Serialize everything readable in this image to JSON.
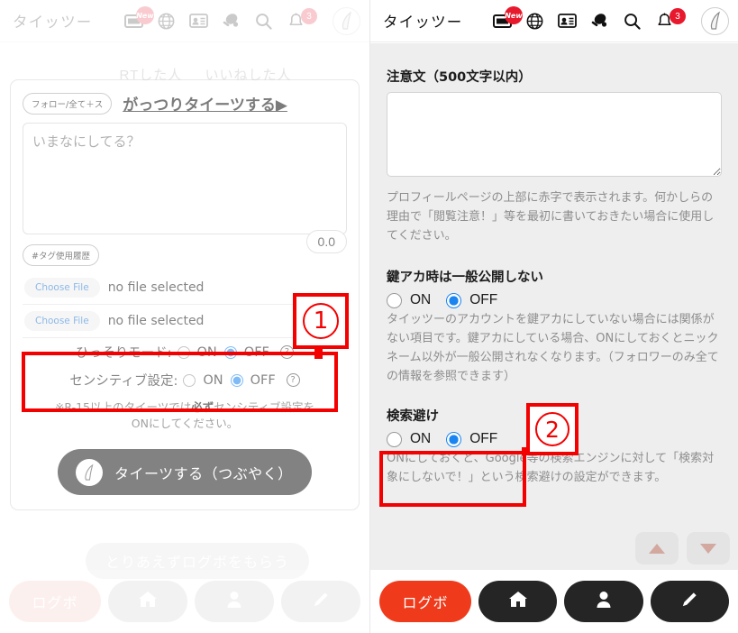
{
  "header": {
    "brand": "タイッツー",
    "icons": [
      {
        "name": "ticket-icon",
        "badge": "New"
      },
      {
        "name": "globe-icon",
        "badge": null
      },
      {
        "name": "id-card-icon",
        "badge": null
      },
      {
        "name": "pingpong-icon",
        "badge": null
      },
      {
        "name": "search-icon",
        "badge": null
      },
      {
        "name": "bell-icon",
        "badge": "3"
      }
    ],
    "avatar": "avatar-icon"
  },
  "left": {
    "backdrop_tabs": [
      "RTした人",
      "いいねした人"
    ],
    "compose": {
      "scope_pill": "フォロー/全て＋ス",
      "gatsuri_label": "がっつりタイーツする▶",
      "textarea_placeholder": "いまなにしてる？",
      "counter": "0.0",
      "tag_history_pill": "#タグ使用履歴",
      "file_rows": [
        {
          "button": "Choose File",
          "status": "no file selected"
        },
        {
          "button": "Choose File",
          "status": "no file selected"
        }
      ],
      "settings": [
        {
          "label": "ひっそりモード:",
          "on_label": "ON",
          "off_label": "OFF",
          "selected": "OFF",
          "help": "?"
        },
        {
          "label": "センシティブ設定:",
          "on_label": "ON",
          "off_label": "OFF",
          "selected": "OFF",
          "help": "?"
        }
      ],
      "note_pre": "※R-15以上のタイーツでは",
      "note_bold": "必ず",
      "note_post": "センシティブ設定を",
      "note_line2": "ONにしてください。",
      "submit_label": "タイーツする（つぶやく）"
    },
    "logbo_get_label": "とりあえずログボをもらう",
    "bottom_nav": [
      {
        "name": "logbo-button",
        "label": "ログボ",
        "icon": null
      },
      {
        "name": "home-button",
        "label": "",
        "icon": "home-icon"
      },
      {
        "name": "profile-button",
        "label": "",
        "icon": "person-icon"
      },
      {
        "name": "compose-button",
        "label": "",
        "icon": "pencil-icon"
      }
    ]
  },
  "right": {
    "notice": {
      "label": "注意文（500文字以内）",
      "value": "",
      "description": "プロフィールページの上部に赤字で表示されます。何かしらの理由で「閲覧注意！」等を最初に書いておきたい場合に使用してください。"
    },
    "private_account": {
      "label": "鍵アカ時は一般公開しない",
      "on_label": "ON",
      "off_label": "OFF",
      "selected": "OFF",
      "description": "タイッツーのアカウントを鍵アカにしていない場合には関係がない項目です。鍵アカにしている場合、ONにしておくとニックネーム以外が一般公開されなくなります。（フォロワーのみ全ての情報を参照できます）"
    },
    "search_avoid": {
      "label": "検索避け",
      "on_label": "ON",
      "off_label": "OFF",
      "selected": "OFF",
      "description": "ONにしておくと、Google等の検索エンジンに対して「検索対象にしないで！」という検索避けの設定ができます。"
    },
    "scroll_up": "▲",
    "scroll_down": "▼",
    "bottom_nav": [
      {
        "name": "logbo-button",
        "label": "ログボ",
        "icon": null
      },
      {
        "name": "home-button",
        "label": "",
        "icon": "home-icon"
      },
      {
        "name": "profile-button",
        "label": "",
        "icon": "person-icon"
      },
      {
        "name": "compose-button",
        "label": "",
        "icon": "pencil-icon"
      }
    ]
  },
  "annotations": [
    {
      "id": "annotation-1",
      "number": "①",
      "glyph": "1"
    },
    {
      "id": "annotation-2",
      "number": "②",
      "glyph": "2"
    }
  ],
  "colors": {
    "accent_red": "#ef3b1c",
    "badge_red": "#e8192c",
    "annotation_red": "#f30000",
    "radio_blue": "#1a85f0",
    "nav_dark": "#252525"
  }
}
